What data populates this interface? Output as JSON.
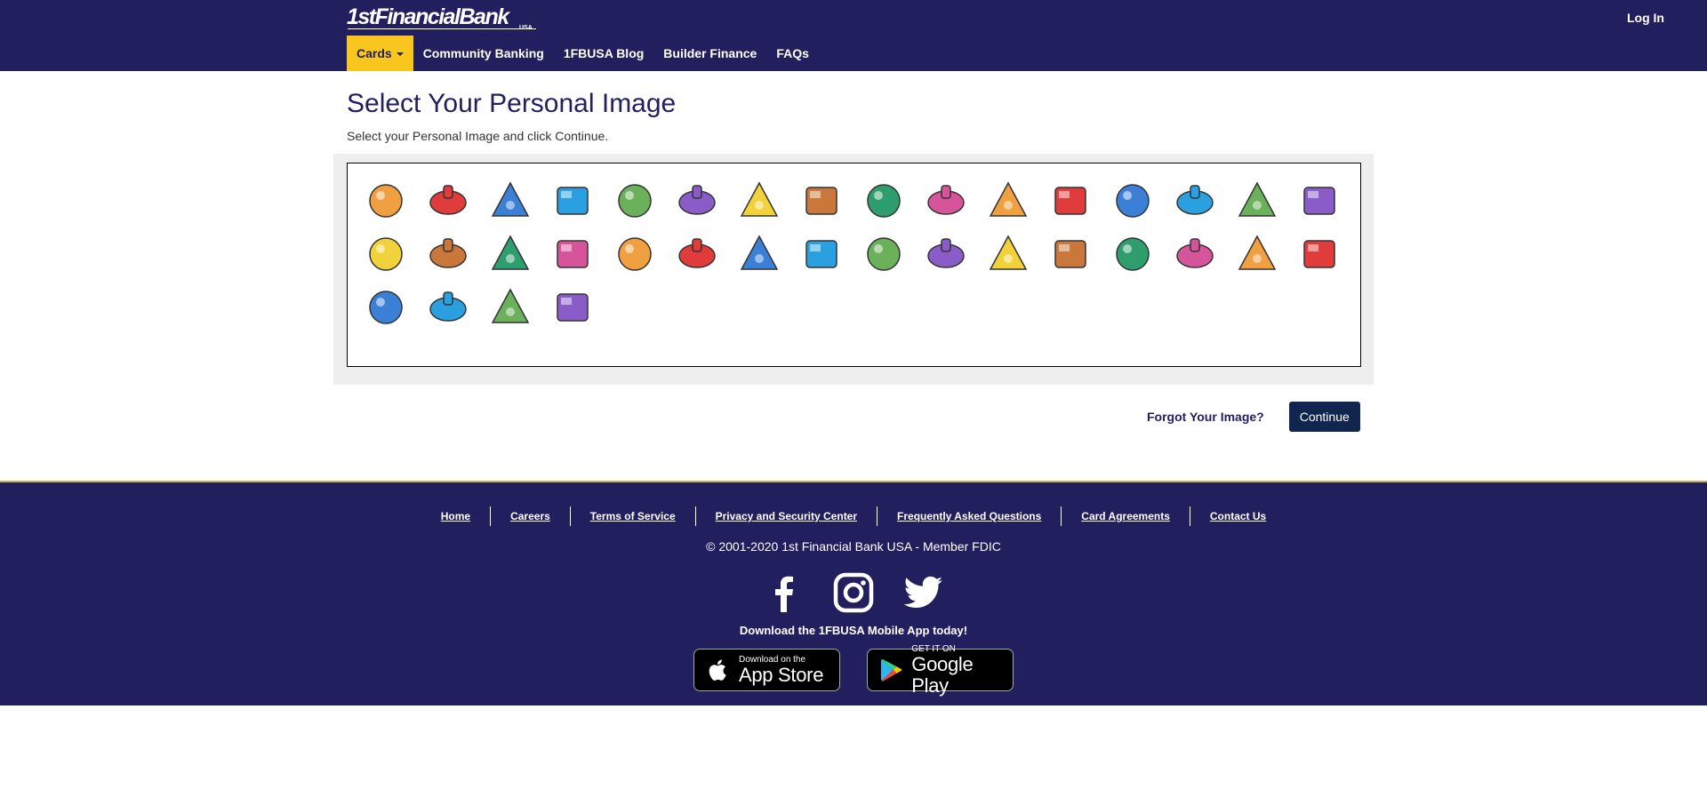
{
  "header": {
    "logo_text": "1stFinancialBank",
    "logo_sub": "USA",
    "login_label": "Log In"
  },
  "nav": {
    "items": [
      {
        "label": "Cards",
        "active": true
      },
      {
        "label": "Community Banking",
        "active": false
      },
      {
        "label": "1FBUSA Blog",
        "active": false
      },
      {
        "label": "Builder Finance",
        "active": false
      },
      {
        "label": "FAQs",
        "active": false
      }
    ]
  },
  "main": {
    "title": "Select Your Personal Image",
    "subtitle": "Select your Personal Image and click Continue.",
    "images": [
      "thumbs-up-icon",
      "magic-wand-icon",
      "gift-icon",
      "dollar-sign-icon",
      "books-icon",
      "ship-icon",
      "music-note-icon",
      "mp3-player-icon",
      "abacus-icon",
      "perfume-bottle-icon",
      "light-bulb-icon",
      "swiss-knife-icon",
      "cd-disc-icon",
      "globe-icon",
      "drum-set-icon",
      "stars-icon",
      "comb-icon",
      "bicycle-icon",
      "wristwatch-icon",
      "soccer-ball-icon",
      "basketball-icon",
      "pda-icon",
      "dice-icon",
      "film-reel-icon",
      "alarm-clock-icon",
      "molecule-icon",
      "target-icon",
      "book-stack-icon",
      "credit-card-icon",
      "brick-wall-icon",
      "motorcycle-icon",
      "telephone-icon",
      "laptop-icon",
      "fire-icon",
      "flask-icon",
      "gold-coin-icon"
    ],
    "forgot_label": "Forgot Your Image?",
    "continue_label": "Continue"
  },
  "footer": {
    "links": [
      "Home",
      "Careers",
      "Terms of Service",
      "Privacy and Security Center",
      "Frequently Asked Questions",
      "Card Agreements",
      "Contact Us"
    ],
    "copyright": "© 2001-2020 1st Financial Bank USA - Member FDIC",
    "social": [
      "facebook-icon",
      "instagram-icon",
      "twitter-icon"
    ],
    "download_text": "Download the 1FBUSA Mobile App today!",
    "app_store": {
      "small": "Download on the",
      "big": "App Store"
    },
    "google_play": {
      "small": "GET IT ON",
      "big": "Google Play"
    }
  },
  "colors": {
    "brand_navy": "#221f5f",
    "accent_yellow": "#f8c61d",
    "button_navy": "#10264f"
  }
}
